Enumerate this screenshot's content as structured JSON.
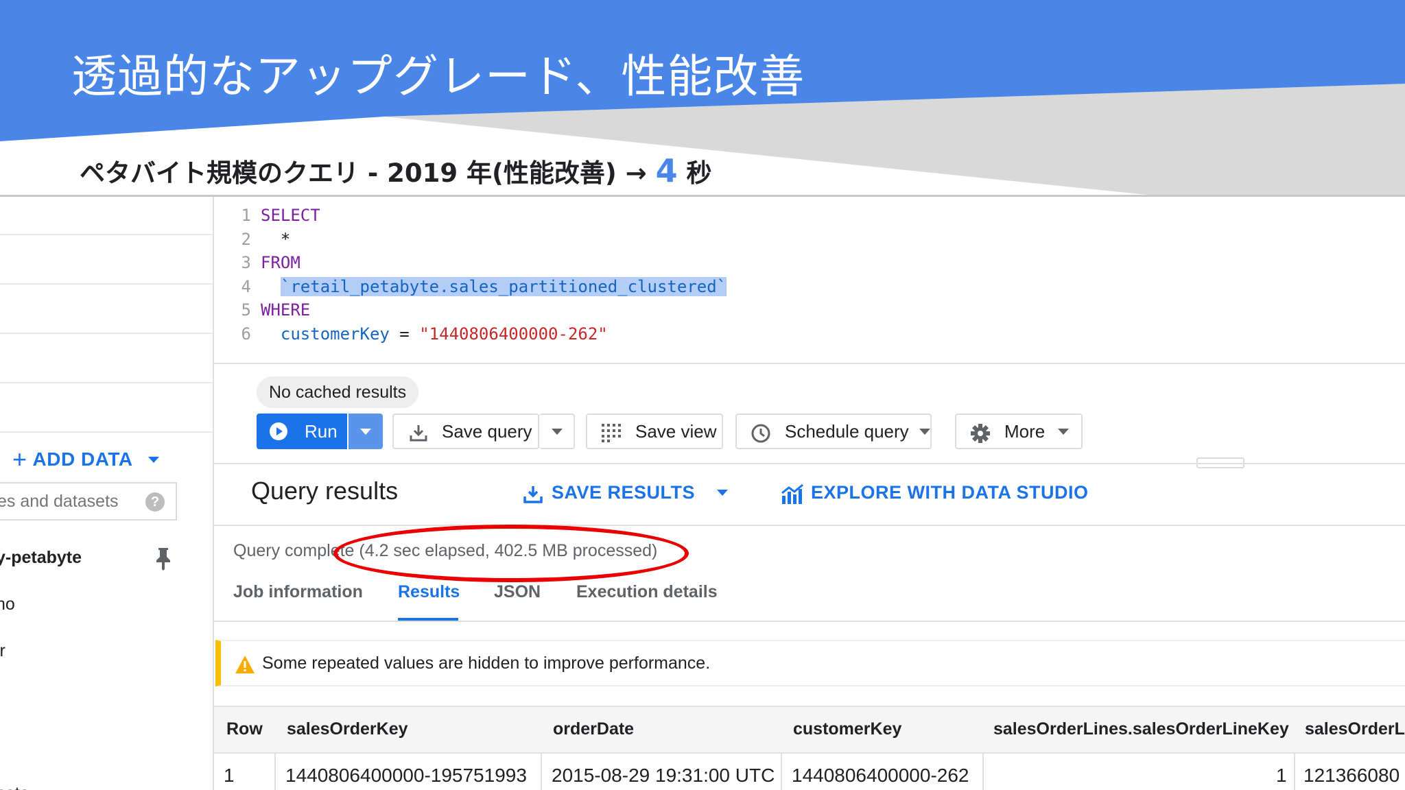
{
  "slide": {
    "title": "透過的なアップグレード、性能改善",
    "subtitle": "ペタバイト規模のクエリ - 2019 年(性能改善)",
    "arrow": "→",
    "duration_value": "4",
    "duration_unit": "秒",
    "colors": {
      "header_blue": "#4a86e8",
      "wedge_gray": "#d9d9d9"
    }
  },
  "left_panel": {
    "add_data_label": "ADD DATA",
    "search_placeholder": "es and datasets",
    "help_icon": "?",
    "project_name": "y-petabyte",
    "items": [
      "no",
      "ir",
      "bete"
    ]
  },
  "editor": {
    "lines": [
      {
        "num": "1",
        "tokens": [
          {
            "text": "SELECT",
            "cls": "kw"
          }
        ]
      },
      {
        "num": "2",
        "tokens": [
          {
            "text": "  *",
            "cls": ""
          }
        ]
      },
      {
        "num": "3",
        "tokens": [
          {
            "text": "FROM",
            "cls": "kw"
          }
        ]
      },
      {
        "num": "4",
        "tokens": [
          {
            "text": "  ",
            "cls": ""
          },
          {
            "text": "`retail_petabyte.sales_partitioned_clustered`",
            "cls": "tbl"
          }
        ]
      },
      {
        "num": "5",
        "tokens": [
          {
            "text": "WHERE",
            "cls": "kw"
          }
        ]
      },
      {
        "num": "6",
        "tokens": [
          {
            "text": "  ",
            "cls": ""
          },
          {
            "text": "customerKey",
            "cls": "fld"
          },
          {
            "text": " = ",
            "cls": ""
          },
          {
            "text": "\"1440806400000-262\"",
            "cls": "str"
          }
        ]
      }
    ]
  },
  "toolbar": {
    "cache_chip": "No cached results",
    "run_label": "Run",
    "save_query_label": "Save query",
    "save_view_label": "Save view",
    "schedule_query_label": "Schedule query",
    "more_label": "More"
  },
  "results": {
    "title": "Query results",
    "save_results_label": "SAVE RESULTS",
    "explore_label": "EXPLORE WITH DATA STUDIO",
    "status": "Query complete (4.2 sec elapsed, 402.5 MB processed)",
    "tabs": [
      {
        "label": "Job information",
        "active": false
      },
      {
        "label": "Results",
        "active": true
      },
      {
        "label": "JSON",
        "active": false
      },
      {
        "label": "Execution details",
        "active": false
      }
    ],
    "warning": "Some repeated values are hidden to improve performance.",
    "columns": [
      "Row",
      "salesOrderKey",
      "orderDate",
      "customerKey",
      "salesOrderLines.salesOrderLineKey",
      "salesOrderLi"
    ],
    "rows": [
      [
        "1",
        "1440806400000-195751993",
        "2015-08-29 19:31:00 UTC",
        "1440806400000-262",
        "1",
        "121366080"
      ]
    ]
  }
}
